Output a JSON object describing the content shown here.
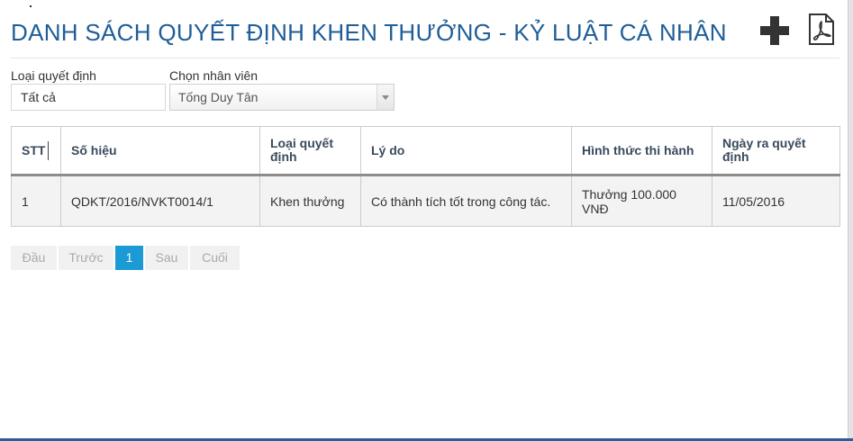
{
  "page": {
    "title": "DANH SÁCH QUYẾT ĐỊNH KHEN THƯỞNG - KỶ LUẬT CÁ NHÂN"
  },
  "toolbar": {
    "add_icon": "plus-icon",
    "pdf_icon": "pdf-icon"
  },
  "filters": {
    "decision_type_label": "Loại quyết định",
    "decision_type_value": "Tất cả",
    "employee_label": "Chọn nhân viên",
    "employee_value": "Tống Duy Tân"
  },
  "table": {
    "columns": [
      "STT",
      "Số hiệu",
      "Loại quyết định",
      "Lý do",
      "Hình thức thi hành",
      "Ngày ra quyết định"
    ],
    "rows": [
      {
        "stt": "1",
        "so_hieu": "QDKT/2016/NVKT0014/1",
        "loai": "Khen thưởng",
        "ly_do": "Có thành tích tốt trong công tác.",
        "hinh_thuc": "Thưởng 100.000 VNĐ",
        "ngay": "11/05/2016"
      }
    ]
  },
  "pagination": {
    "first": "Đầu",
    "prev": "Trước",
    "pages": [
      "1"
    ],
    "next": "Sau",
    "last": "Cuối",
    "current": "1"
  },
  "colors": {
    "title": "#1f5e98",
    "active_page": "#1b9ad6",
    "bottom_bar": "#2a5d9b"
  }
}
